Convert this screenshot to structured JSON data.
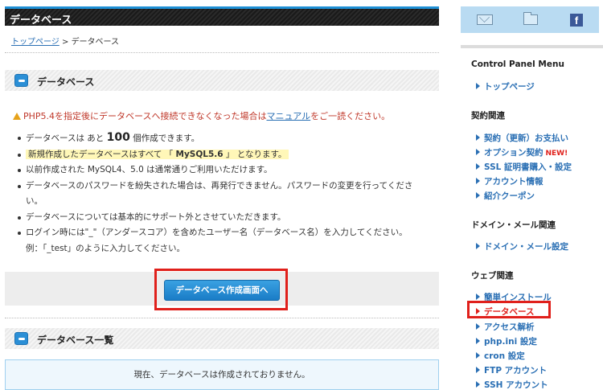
{
  "page": {
    "header_title": "データベース",
    "breadcrumb": {
      "home_link": "トップページ",
      "separator": " > ",
      "current": "データベース"
    }
  },
  "section_db": {
    "title": "データベース"
  },
  "warning": {
    "prefix": "PHP5.4を指定後にデータベースへ接続できなくなった場合は",
    "link": "マニュアル",
    "suffix": "をご一読ください。"
  },
  "notes": {
    "item1_a": "データベースは あと ",
    "item1_count": "100",
    "item1_b": " 個作成できます。",
    "item2_a": "新規作成したデータベースはすべて 「 ",
    "item2_version": "MySQL5.6",
    "item2_b": " 」 となります。",
    "item3": "以前作成された MySQL4、5.0 は通常通りご利用いただけます。",
    "item4_line1": "データベースのパスワードを紛失された場合は、再発行できません。パスワードの変更を行ってくださ",
    "item4_line2": "い。",
    "item5": "データベースについては基本的にサポート外とさせていただきます。",
    "item6_line1": "ログイン時には\"_\"（アンダースコア）を含めたユーザー名（データベース名）を入力してください。",
    "item6_line2": "例：「_test」のように入力してください。"
  },
  "cta": {
    "label": "データベース作成画面へ"
  },
  "section_list": {
    "title": "データベース一覧"
  },
  "empty_message": "現在、データベースは作成されておりません。",
  "sidebar": {
    "fb_glyph": "f",
    "menu_title": "Control Panel Menu",
    "top_link": "トップページ",
    "group_contract": "契約関連",
    "contract_links": [
      "契約（更新）お支払い",
      "オプション契約",
      "SSL 証明書購入・設定",
      "アカウント情報",
      "紹介クーポン"
    ],
    "new_badge": "NEW!",
    "group_domain": "ドメイン・メール関連",
    "domain_links": [
      "ドメイン・メール設定"
    ],
    "group_web": "ウェブ関連",
    "web_links": [
      "簡単インストール",
      "データベース",
      "アクセス解析",
      "php.ini 設定",
      "cron 設定",
      "FTP アカウント",
      "SSH アカウント"
    ]
  },
  "colors": {
    "accent": "#1e90d6",
    "alert": "#e0201b",
    "link": "#2a6fb4"
  }
}
